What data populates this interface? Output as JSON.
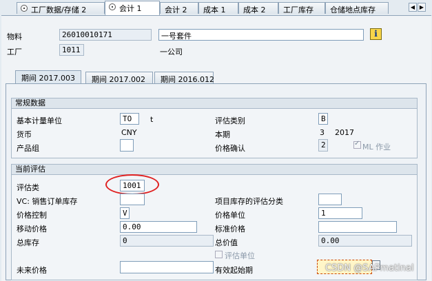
{
  "tabs": [
    {
      "label": "工厂数据/存储 2"
    },
    {
      "label": "会计 1"
    },
    {
      "label": "会计 2"
    },
    {
      "label": "成本 1"
    },
    {
      "label": "成本 2"
    },
    {
      "label": "工厂库存"
    },
    {
      "label": "仓储地点库存"
    }
  ],
  "header": {
    "material_label": "物料",
    "material_value": "26010010171",
    "material_desc": "一号套件",
    "plant_label": "工厂",
    "plant_value": "1011",
    "plant_desc": "一公司"
  },
  "period_tabs": [
    {
      "label": "期间 2017.003"
    },
    {
      "label": "期间 2017.002"
    },
    {
      "label": "期间 2016.012"
    }
  ],
  "general": {
    "title": "常规数据",
    "base_uom_label": "基本计量单位",
    "base_uom_value": "TO",
    "base_uom_unit": "t",
    "valuation_cat_label": "评估类别",
    "valuation_cat_value": "B",
    "currency_label": "货币",
    "currency_value": "CNY",
    "current_period_label": "本期",
    "current_period_month": "3",
    "current_period_year": "2017",
    "product_group_label": "产品组",
    "product_group_value": "",
    "price_determ_label": "价格确认",
    "price_determ_value": "2",
    "ml_label": "ML 作业",
    "ml_checked": true
  },
  "current_valuation": {
    "title": "当前评估",
    "valuation_class_label": "评估类",
    "valuation_class_value": "1001",
    "vc_sales_label": "VC: 销售订单库存",
    "vc_sales_value": "",
    "proj_stock_label": "项目库存的评估分类",
    "proj_stock_value": "",
    "price_control_label": "价格控制",
    "price_control_value": "V",
    "price_unit_label": "价格单位",
    "price_unit_value": "1",
    "moving_price_label": "移动价格",
    "moving_price_value": "0.00",
    "standard_price_label": "标准价格",
    "standard_price_value": "",
    "total_stock_label": "总库存",
    "total_stock_value": "0",
    "total_value_label": "总价值",
    "total_value_value": "0.00",
    "valuated_unit_label": "评估单位",
    "future_price_label": "未来价格",
    "future_price_value": "",
    "valid_from_label": "有效起始期",
    "valid_from_value": ""
  },
  "watermark": "CSDN @SAPmatinal",
  "colors": {
    "highlight_circle": "#e02020",
    "info_button": "#f7d54a"
  }
}
